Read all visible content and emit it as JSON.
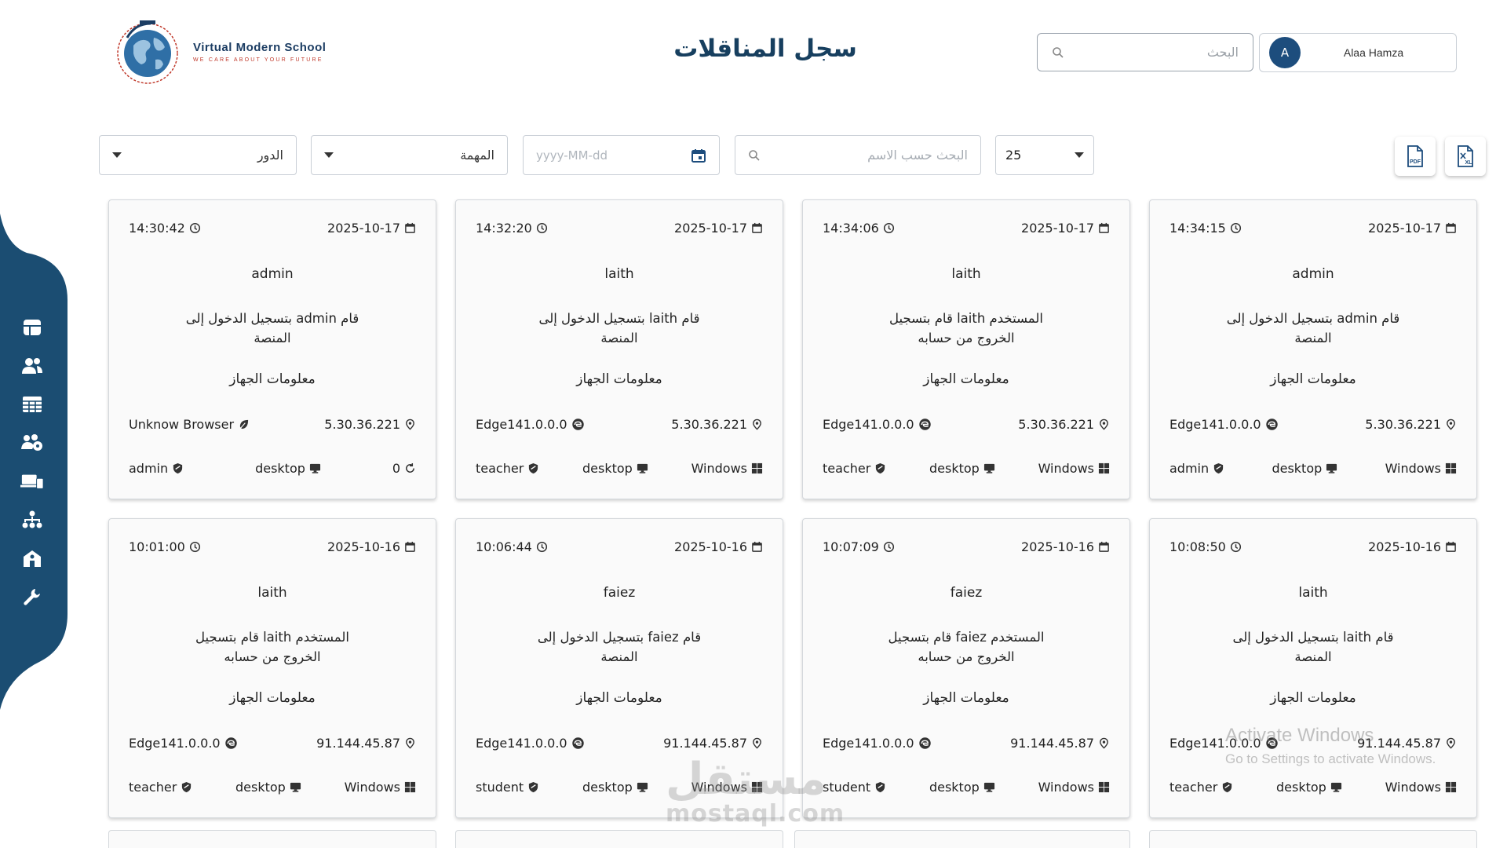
{
  "header": {
    "logo_title": "Virtual Modern School",
    "logo_tagline": "WE CARE ABOUT YOUR FUTURE",
    "page_title": "سجل المناقلات",
    "search_placeholder": "البحث",
    "user_initial": "A",
    "user_name": "Alaa Hamza"
  },
  "filters": {
    "role_label": "الدور",
    "task_label": "المهمة",
    "date_placeholder": "yyyy-MM-dd",
    "name_search_placeholder": "البحث حسب الاسم",
    "page_size": "25",
    "export_pdf": "PDF",
    "export_excel": "XL"
  },
  "sidebar": {
    "icons": [
      "dashboard-icon",
      "users-icon",
      "table-icon",
      "group-icon",
      "devices-icon",
      "hierarchy-icon",
      "school-icon",
      "wrench-icon"
    ]
  },
  "cards": [
    {
      "date": "2025-10-17",
      "time": "14:30:42",
      "user": "admin",
      "action": "قام admin بتسجيل الدخول إلى المنصة",
      "device_title": "معلومات الجهاز",
      "ip": "5.30.36.221",
      "browser": "Unknow Browser",
      "role": "admin",
      "device": "desktop",
      "os": "0",
      "os_icon": "refresh-icon",
      "browser_icon": "leaf-icon"
    },
    {
      "date": "2025-10-17",
      "time": "14:32:20",
      "user": "laith",
      "action": "قام laith بتسجيل الدخول إلى المنصة",
      "device_title": "معلومات الجهاز",
      "ip": "5.30.36.221",
      "browser": "Edge141.0.0.0",
      "role": "teacher",
      "device": "desktop",
      "os": "Windows",
      "os_icon": "windows-icon",
      "browser_icon": "edge-icon"
    },
    {
      "date": "2025-10-17",
      "time": "14:34:06",
      "user": "laith",
      "action": "المستخدم laith قام بتسجيل الخروج من حسابه",
      "device_title": "معلومات الجهاز",
      "ip": "5.30.36.221",
      "browser": "Edge141.0.0.0",
      "role": "teacher",
      "device": "desktop",
      "os": "Windows",
      "os_icon": "windows-icon",
      "browser_icon": "edge-icon"
    },
    {
      "date": "2025-10-17",
      "time": "14:34:15",
      "user": "admin",
      "action": "قام admin بتسجيل الدخول إلى المنصة",
      "device_title": "معلومات الجهاز",
      "ip": "5.30.36.221",
      "browser": "Edge141.0.0.0",
      "role": "admin",
      "device": "desktop",
      "os": "Windows",
      "os_icon": "windows-icon",
      "browser_icon": "edge-icon"
    },
    {
      "date": "2025-10-16",
      "time": "10:01:00",
      "user": "laith",
      "action": "المستخدم laith قام بتسجيل الخروج من حسابه",
      "device_title": "معلومات الجهاز",
      "ip": "91.144.45.87",
      "browser": "Edge141.0.0.0",
      "role": "teacher",
      "device": "desktop",
      "os": "Windows",
      "os_icon": "windows-icon",
      "browser_icon": "edge-icon"
    },
    {
      "date": "2025-10-16",
      "time": "10:06:44",
      "user": "faiez",
      "action": "قام faiez بتسجيل الدخول إلى المنصة",
      "device_title": "معلومات الجهاز",
      "ip": "91.144.45.87",
      "browser": "Edge141.0.0.0",
      "role": "student",
      "device": "desktop",
      "os": "Windows",
      "os_icon": "windows-icon",
      "browser_icon": "edge-icon"
    },
    {
      "date": "2025-10-16",
      "time": "10:07:09",
      "user": "faiez",
      "action": "المستخدم faiez قام بتسجيل الخروج من حسابه",
      "device_title": "معلومات الجهاز",
      "ip": "91.144.45.87",
      "browser": "Edge141.0.0.0",
      "role": "student",
      "device": "desktop",
      "os": "Windows",
      "os_icon": "windows-icon",
      "browser_icon": "edge-icon"
    },
    {
      "date": "2025-10-16",
      "time": "10:08:50",
      "user": "laith",
      "action": "قام laith بتسجيل الدخول إلى المنصة",
      "device_title": "معلومات الجهاز",
      "ip": "91.144.45.87",
      "browser": "Edge141.0.0.0",
      "role": "teacher",
      "device": "desktop",
      "os": "Windows",
      "os_icon": "windows-icon",
      "browser_icon": "edge-icon"
    }
  ],
  "watermark": {
    "line1": "Activate Windows",
    "line2": "Go to Settings to activate Windows.",
    "brand_ar": "مستقل",
    "brand_en": "mostaql.com"
  },
  "colors": {
    "primary": "#173f5f",
    "sidebar": "#1b4d72",
    "avatar": "#1d4d7d"
  }
}
